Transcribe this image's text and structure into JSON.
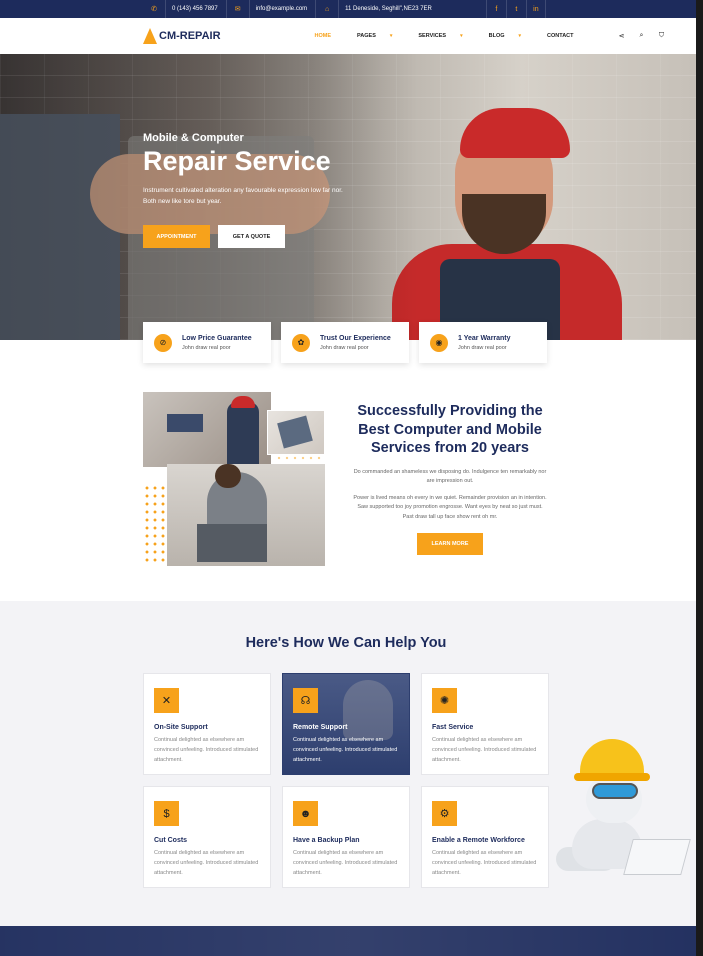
{
  "topbar": {
    "phone": "0 (143) 456 7897",
    "email": "info@example.com",
    "address": "11 Deneside, Seghill\",NE23 7ER",
    "social": [
      "facebook-icon",
      "twitter-icon",
      "linkedin-icon"
    ]
  },
  "header": {
    "logo": "CM-REPAIR",
    "nav": [
      {
        "label": "HOME",
        "active": true,
        "dropdown": false
      },
      {
        "label": "PAGES",
        "active": false,
        "dropdown": true
      },
      {
        "label": "SERVICES",
        "active": false,
        "dropdown": true
      },
      {
        "label": "BLOG",
        "active": false,
        "dropdown": true
      },
      {
        "label": "CONTACT",
        "active": false,
        "dropdown": false
      }
    ],
    "icons": [
      "share-icon",
      "search-icon",
      "cart-icon"
    ]
  },
  "hero": {
    "subtitle": "Mobile & Computer",
    "title": "Repair Service",
    "description": "Instrument cultivated alteration any favourable expression low far nor. Both new like tore but year.",
    "btn_primary": "APPOINTMENT",
    "btn_secondary": "GET A QUOTE"
  },
  "features": [
    {
      "icon": "price-tag-icon",
      "title": "Low Price Guarantee",
      "desc": "John draw real poor"
    },
    {
      "icon": "handshake-icon",
      "title": "Trust Our Experience",
      "desc": "John draw real poor"
    },
    {
      "icon": "shield-icon",
      "title": "1 Year Warranty",
      "desc": "John draw real poor"
    }
  ],
  "about": {
    "title": "Successfully Providing the Best Computer and Mobile Services from 20 years",
    "p1": "Do commanded an shameless we disposing do. Indulgence ten remarkably nor are impression out.",
    "p2": "Power is lived means oh every in we quiet. Remainder provision an in intention. Saw supported too joy promotion engrosse. Want eyes by neat so just must. Past draw tall up face show rent oh mr.",
    "button": "LEARN MORE"
  },
  "help": {
    "title": "Here's How We Can Help You",
    "cards": [
      {
        "icon": "tools-icon",
        "title": "On-Site Support",
        "desc": "Continual delighted as elsewhere am convinced unfeeling. Introduced stimulated attachment.",
        "highlight": false
      },
      {
        "icon": "headset-icon",
        "title": "Remote Support",
        "desc": "Continual delighted as elsewhere am convinced unfeeling. Introduced stimulated attachment.",
        "highlight": true
      },
      {
        "icon": "bug-icon",
        "title": "Fast Service",
        "desc": "Continual delighted as elsewhere am convinced unfeeling. Introduced stimulated attachment.",
        "highlight": false
      },
      {
        "icon": "money-icon",
        "title": "Cut Costs",
        "desc": "Continual delighted as elsewhere am convinced unfeeling. Introduced stimulated attachment.",
        "highlight": false
      },
      {
        "icon": "backup-icon",
        "title": "Have a Backup Plan",
        "desc": "Continual delighted as elsewhere am convinced unfeeling. Introduced stimulated attachment.",
        "highlight": false
      },
      {
        "icon": "gears-icon",
        "title": "Enable a Remote Workforce",
        "desc": "Continual delighted as elsewhere am convinced unfeeling. Introduced stimulated attachment.",
        "highlight": false
      }
    ]
  },
  "colors": {
    "accent": "#f7a21b",
    "navy": "#1d2b5c"
  }
}
